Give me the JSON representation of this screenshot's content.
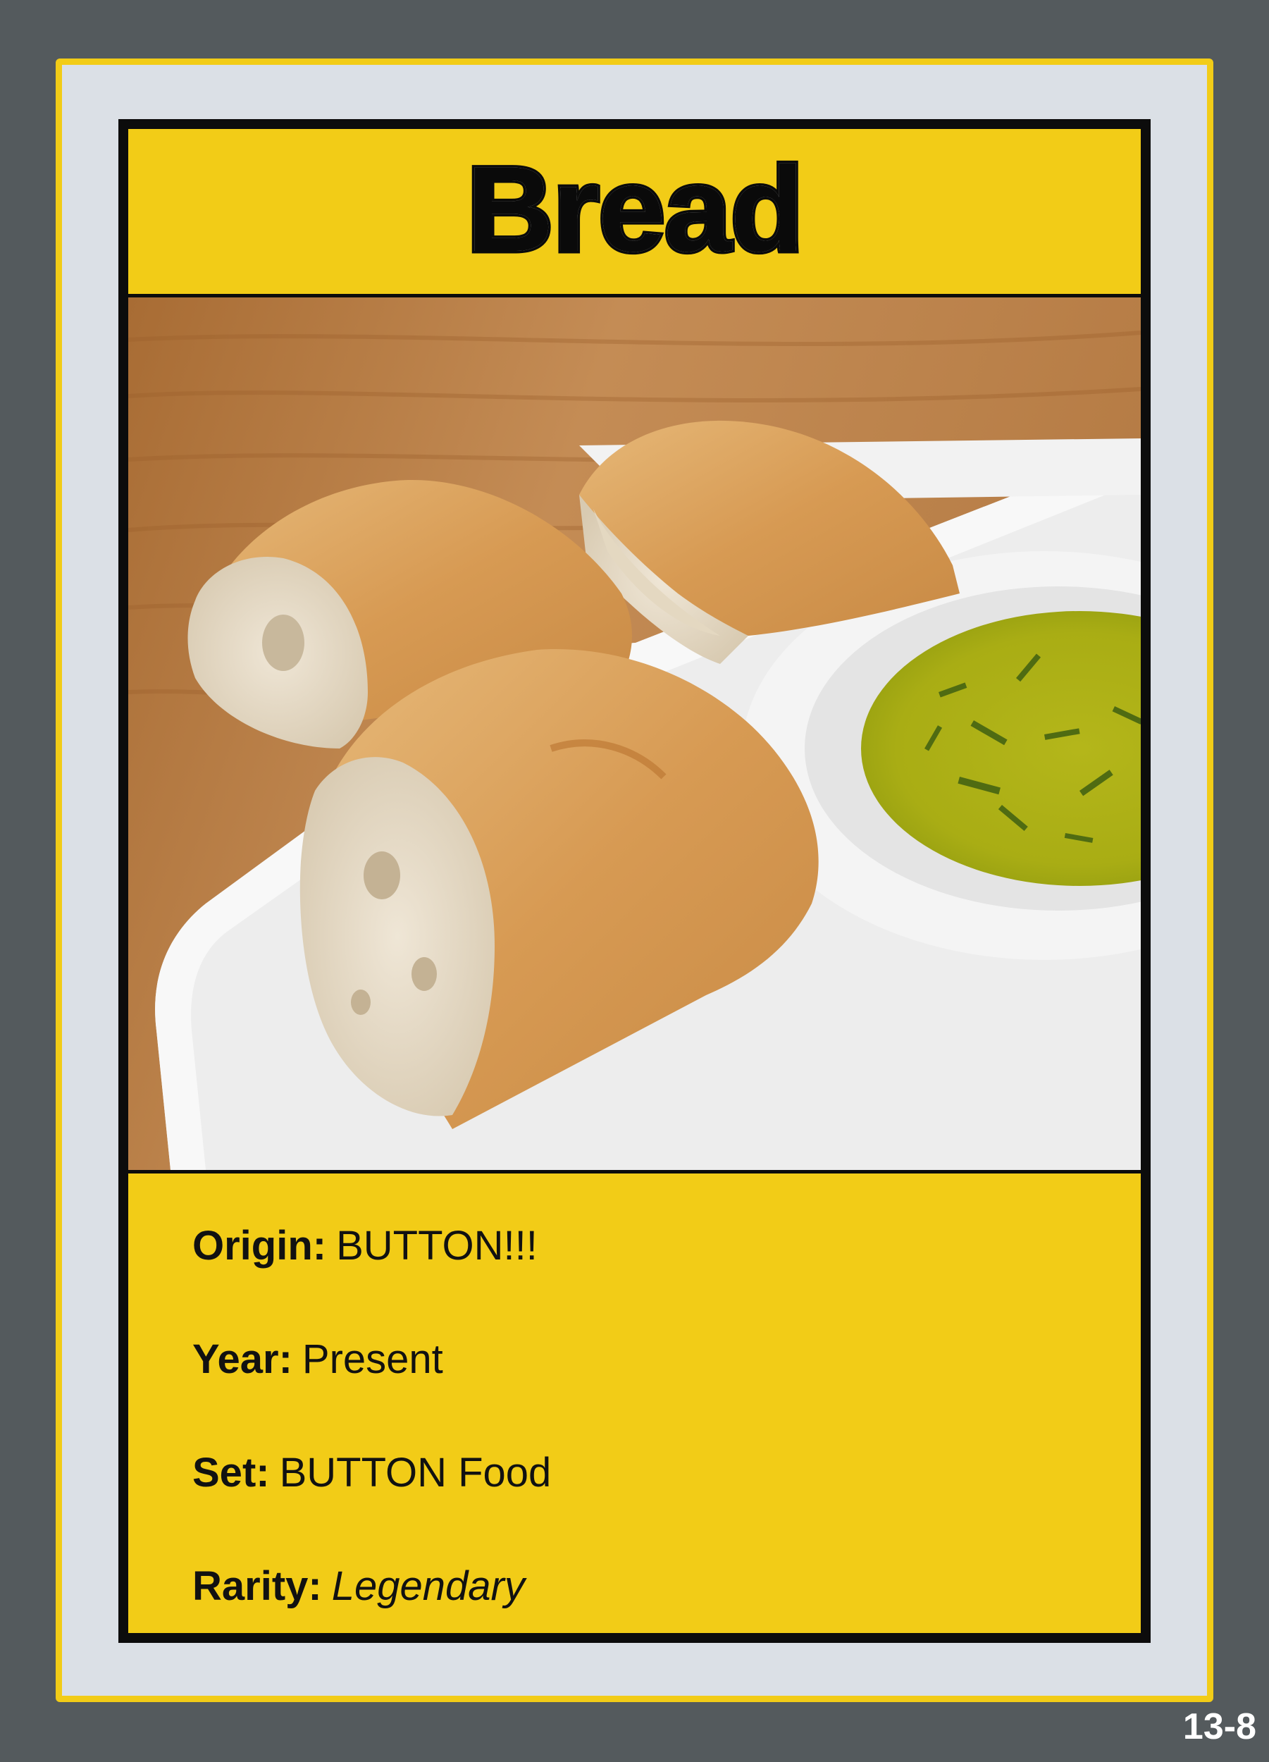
{
  "card": {
    "title": "Bread",
    "number": "13-8",
    "photo_icon": "bread-with-olive-oil-photo",
    "stats": [
      {
        "label": "Origin:",
        "value": "BUTTON!!!",
        "italic": false
      },
      {
        "label": "Year:",
        "value": "Present",
        "italic": false
      },
      {
        "label": "Set:",
        "value": "BUTTON Food",
        "italic": false
      },
      {
        "label": "Rarity:",
        "value": "Legendary",
        "italic": true
      }
    ]
  },
  "colors": {
    "background": "#545a5d",
    "card_yellow": "#f2cc17",
    "frame_gray": "#dbe0e6",
    "border_black": "#0c0c0c"
  }
}
